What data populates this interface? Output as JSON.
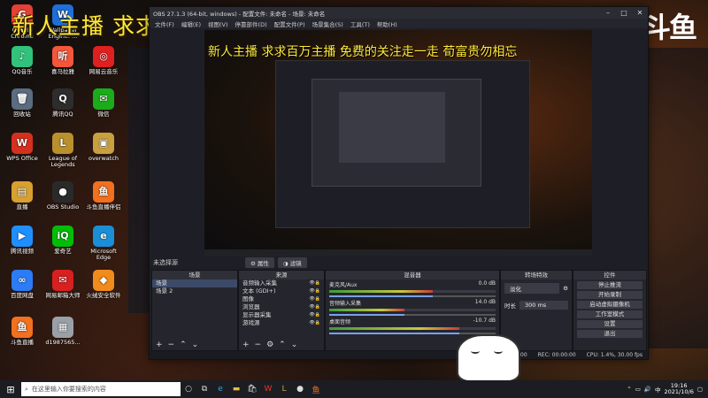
{
  "banner_text": "新人主播 求求百万主播 免费的关注走一走 荀富贵勿相忘",
  "logo": "斗鱼",
  "desktop_icons": [
    {
      "label": "Google Chrome",
      "glyph": "G",
      "color": "#e34133"
    },
    {
      "label": "Wallpaper Engine: ...",
      "glyph": "W",
      "color": "#1e6fd9"
    },
    {
      "label": "QQ音乐",
      "glyph": "♪",
      "color": "#31c27c"
    },
    {
      "label": "喜马拉雅",
      "glyph": "听",
      "color": "#f4563a"
    },
    {
      "label": "网易云音乐",
      "glyph": "◎",
      "color": "#e02020"
    },
    {
      "label": "回收站",
      "glyph": "🗑",
      "color": "#5b6b80"
    },
    {
      "label": "腾讯QQ",
      "glyph": "Q",
      "color": "#2d2d2d"
    },
    {
      "label": "微信",
      "glyph": "✉",
      "color": "#1aad19"
    },
    {
      "label": "WPS Office",
      "glyph": "W",
      "color": "#d5301f"
    },
    {
      "label": "League of Legends",
      "glyph": "L",
      "color": "#b8902e"
    },
    {
      "label": "overwatch",
      "glyph": "▣",
      "color": "#c8a040"
    },
    {
      "label": "直播",
      "glyph": "▤",
      "color": "#d8a030"
    },
    {
      "label": "OBS Studio",
      "glyph": "●",
      "color": "#2a2a2a"
    },
    {
      "label": "斗鱼直播伴侣",
      "glyph": "鱼",
      "color": "#f27020"
    },
    {
      "label": "腾讯视频",
      "glyph": "▶",
      "color": "#1f8fff"
    },
    {
      "label": "爱奇艺",
      "glyph": "iQ",
      "color": "#00be06"
    },
    {
      "label": "Microsoft Edge",
      "glyph": "e",
      "color": "#1a8fd8"
    },
    {
      "label": "百度网盘",
      "glyph": "∞",
      "color": "#2b7cf6"
    },
    {
      "label": "网易邮箱大师",
      "glyph": "✉",
      "color": "#d82020"
    },
    {
      "label": "火绒安全软件",
      "glyph": "◆",
      "color": "#f08c1c"
    },
    {
      "label": "斗鱼直播",
      "glyph": "鱼",
      "color": "#f27020"
    },
    {
      "label": "d1987565...",
      "glyph": "▦",
      "color": "#9aa0a8"
    }
  ],
  "obs": {
    "title": "OBS 27.1.3 (64-bit, windows) - 配置文件: 未命名 - 场景: 未命名",
    "menu": [
      "文件(F)",
      "编辑(E)",
      "视图(V)",
      "停靠部件(D)",
      "配置文件(P)",
      "场景集合(S)",
      "工具(T)",
      "帮助(H)"
    ],
    "source_label": "未选择源",
    "properties_label": "属性",
    "filters_label": "滤镜",
    "scenes": {
      "header": "场景",
      "items": [
        "场景",
        "场景 2"
      ]
    },
    "sources": {
      "header": "来源",
      "items": [
        "音频输入采集",
        "文本 (GDI+)",
        "图像",
        "浏览器",
        "显示器采集",
        "游戏源"
      ]
    },
    "mixer": {
      "header": "混音器",
      "channels": [
        {
          "name": "麦克风/Aux",
          "db": "0.0 dB",
          "level": 0.62
        },
        {
          "name": "音频输入采集",
          "db": "14.0 dB",
          "level": 0.45
        },
        {
          "name": "桌面音频",
          "db": "-10.7 dB",
          "level": 0.78
        }
      ]
    },
    "transitions": {
      "header": "转场特效",
      "selected": "淡化",
      "duration_label": "时长",
      "duration": "300 ms"
    },
    "controls": {
      "header": "控件",
      "buttons": [
        "停止推流",
        "开始录制",
        "启动虚拟摄像机",
        "工作室模式",
        "设置",
        "退出"
      ]
    },
    "status": {
      "live": "LIVE: 00:00:00",
      "rec": "REC: 00:00:00",
      "cpu": "CPU: 1.4%, 30.00 fps"
    }
  },
  "taskbar": {
    "search_placeholder": "在这里输入你要搜索的内容",
    "time": "19:16",
    "date": "2021/10/6"
  }
}
